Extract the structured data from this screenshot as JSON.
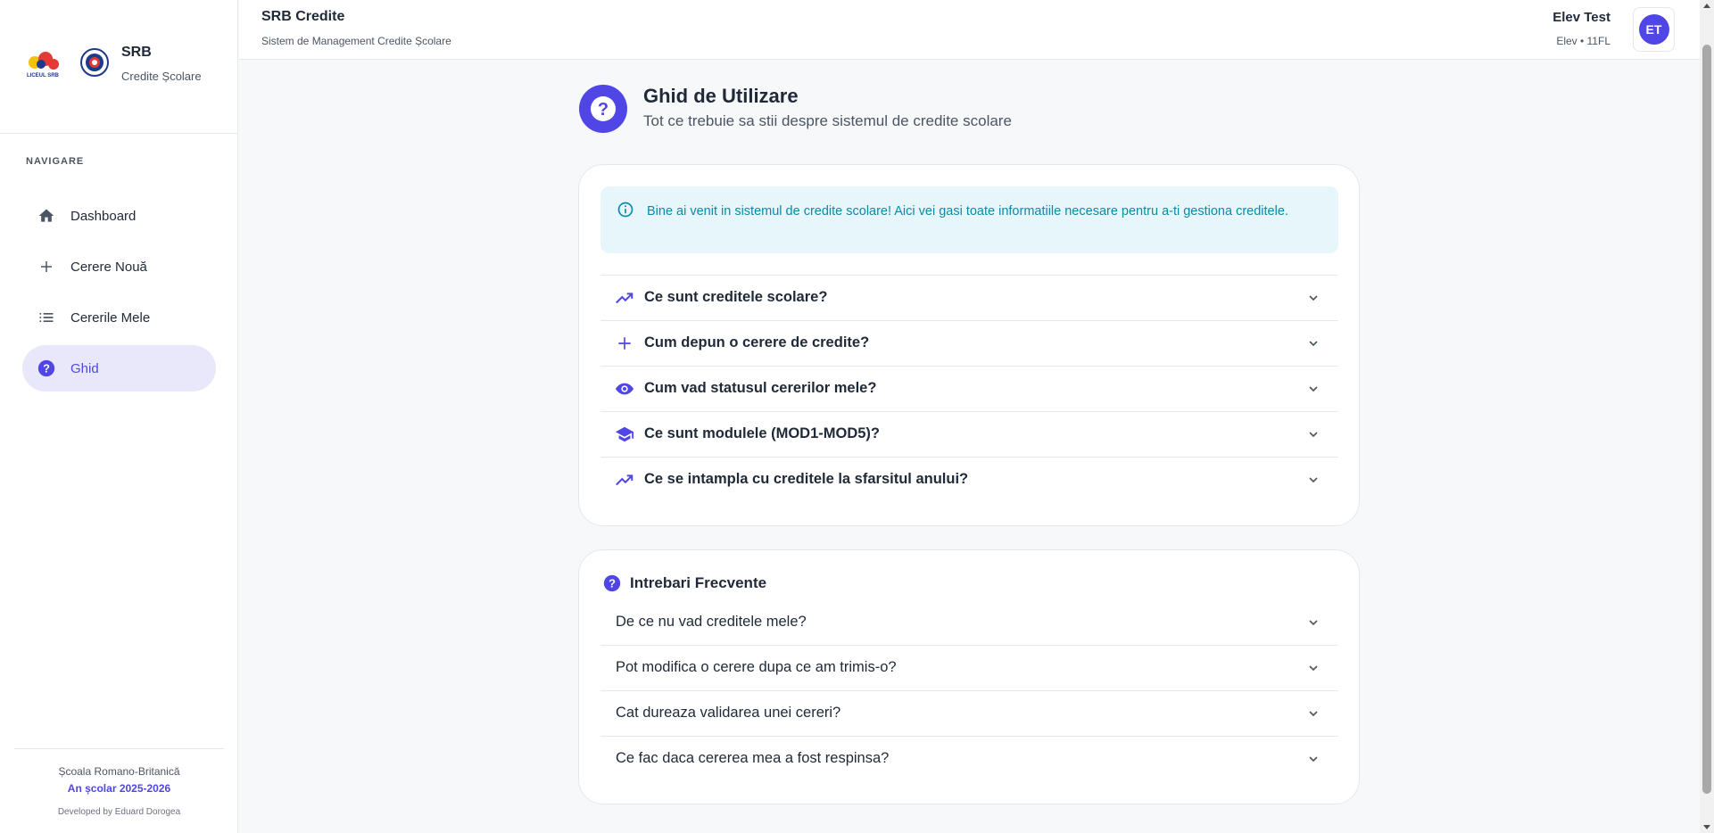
{
  "brand": {
    "title": "SRB",
    "subtitle": "Credite Școlare",
    "logo_text": "LICEUL SRB"
  },
  "sidebar": {
    "heading": "NAVIGARE",
    "items": [
      {
        "label": "Dashboard",
        "icon": "home-icon"
      },
      {
        "label": "Cerere Nouă",
        "icon": "plus-icon"
      },
      {
        "label": "Cererile Mele",
        "icon": "list-icon"
      },
      {
        "label": "Ghid",
        "icon": "help-circle-icon",
        "active": true
      }
    ],
    "footer": {
      "school": "Școala Romano-Britanică",
      "year": "An școlar 2025-2026",
      "developer": "Developed by Eduard Dorogea"
    }
  },
  "header": {
    "title": "SRB Credite",
    "subtitle": "Sistem de Management Credite Școlare",
    "user_name": "Elev Test",
    "user_role": "Elev • 11FL",
    "avatar_initials": "ET"
  },
  "page": {
    "title": "Ghid de Utilizare",
    "subtitle": "Tot ce trebuie sa stii despre sistemul de credite scolare"
  },
  "guide": {
    "alert": "Bine ai venit in sistemul de credite scolare! Aici vei gasi toate informatiile necesare pentru a-ti gestiona creditele.",
    "sections": [
      {
        "title": "Ce sunt creditele scolare?",
        "icon": "trending-up-icon"
      },
      {
        "title": "Cum depun o cerere de credite?",
        "icon": "plus-icon"
      },
      {
        "title": "Cum vad statusul cererilor mele?",
        "icon": "eye-icon"
      },
      {
        "title": "Ce sunt modulele (MOD1-MOD5)?",
        "icon": "graduation-cap-icon"
      },
      {
        "title": "Ce se intampla cu creditele la sfarsitul anului?",
        "icon": "trending-up-icon"
      }
    ]
  },
  "faq": {
    "title": "Intrebari Frecvente",
    "items": [
      {
        "question": "De ce nu vad creditele mele?"
      },
      {
        "question": "Pot modifica o cerere dupa ce am trimis-o?"
      },
      {
        "question": "Cat dureaza validarea unei cereri?"
      },
      {
        "question": "Ce fac daca cererea mea a fost respinsa?"
      }
    ]
  },
  "colors": {
    "accent": "#4f46e5",
    "accent_light": "#e9e8fb",
    "info_bg": "#e6f6fa",
    "info_text": "#0b8aa8",
    "background": "#f7f8fa"
  }
}
